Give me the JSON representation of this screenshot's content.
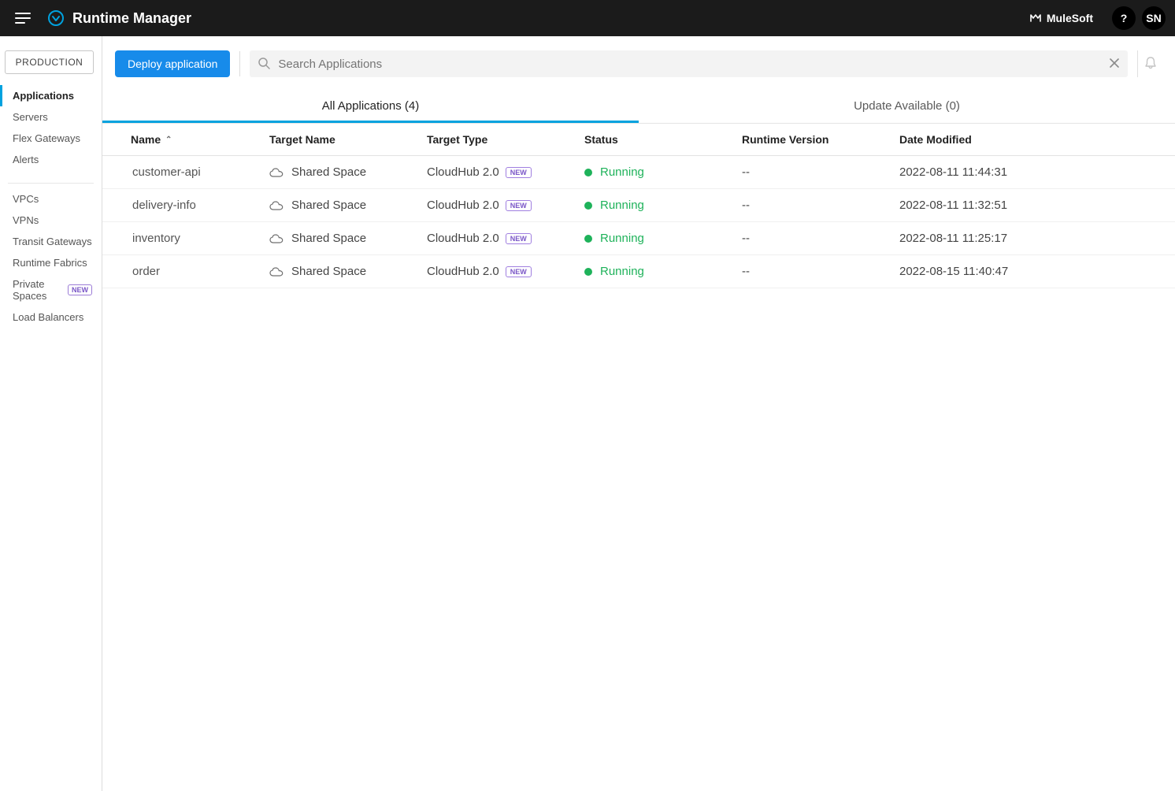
{
  "topbar": {
    "title": "Runtime Manager",
    "brand_label": "MuleSoft",
    "help_label": "?",
    "user_initials": "SN"
  },
  "sidebar": {
    "environment": "PRODUCTION",
    "group1": [
      {
        "label": "Applications",
        "active": true
      },
      {
        "label": "Servers"
      },
      {
        "label": "Flex Gateways"
      },
      {
        "label": "Alerts"
      }
    ],
    "group2": [
      {
        "label": "VPCs"
      },
      {
        "label": "VPNs"
      },
      {
        "label": "Transit Gateways"
      },
      {
        "label": "Runtime Fabrics"
      },
      {
        "label": "Private Spaces",
        "new_badge": "NEW"
      },
      {
        "label": "Load Balancers"
      }
    ]
  },
  "actionbar": {
    "deploy_label": "Deploy application",
    "search_placeholder": "Search Applications"
  },
  "tabs": {
    "all_label": "All Applications (4)",
    "update_label": "Update Available (0)"
  },
  "table": {
    "columns": {
      "name": "Name",
      "target": "Target Name",
      "type": "Target Type",
      "status": "Status",
      "version": "Runtime Version",
      "date": "Date Modified"
    },
    "new_pill": "NEW",
    "rows": [
      {
        "name": "customer-api",
        "target": "Shared Space",
        "type": "CloudHub 2.0",
        "status": "Running",
        "version": "--",
        "date": "2022-08-11 11:44:31"
      },
      {
        "name": "delivery-info",
        "target": "Shared Space",
        "type": "CloudHub 2.0",
        "status": "Running",
        "version": "--",
        "date": "2022-08-11 11:32:51"
      },
      {
        "name": "inventory",
        "target": "Shared Space",
        "type": "CloudHub 2.0",
        "status": "Running",
        "version": "--",
        "date": "2022-08-11 11:25:17"
      },
      {
        "name": "order",
        "target": "Shared Space",
        "type": "CloudHub 2.0",
        "status": "Running",
        "version": "--",
        "date": "2022-08-15 11:40:47"
      }
    ]
  }
}
